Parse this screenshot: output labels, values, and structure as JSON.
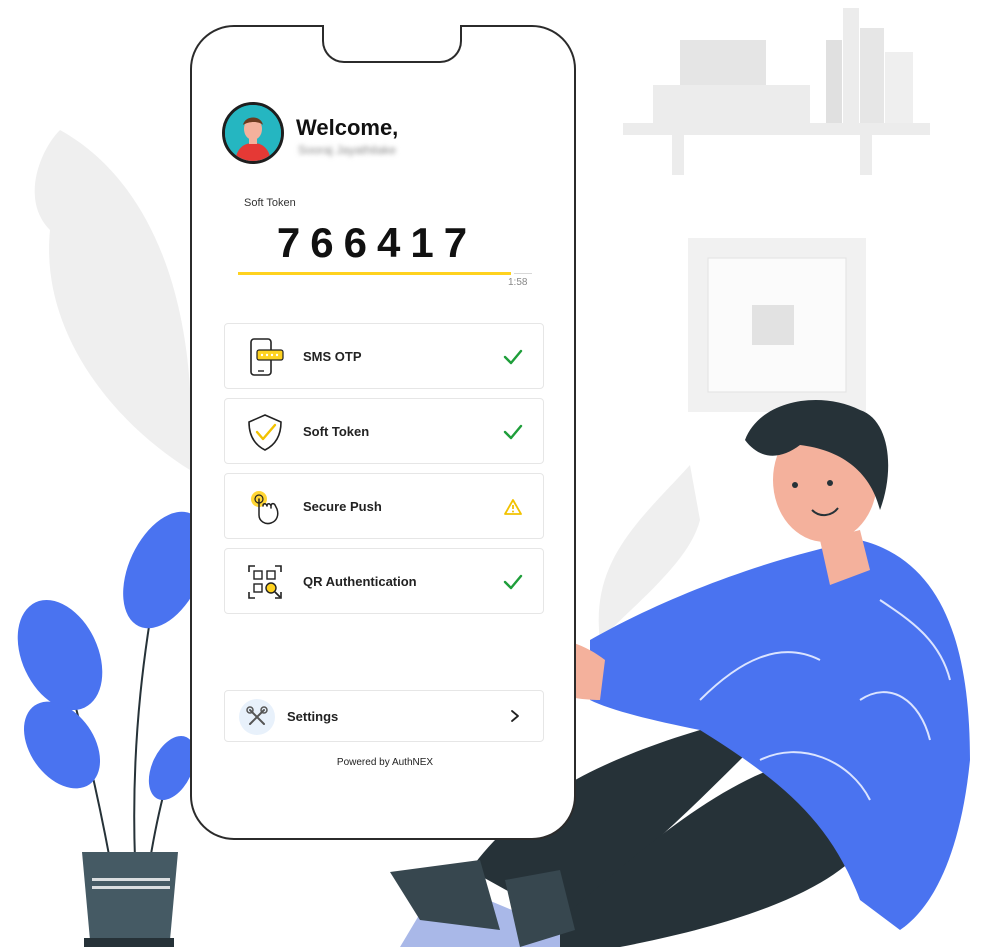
{
  "welcome": {
    "greeting": "Welcome,",
    "username": "Sooraj Jayathilake"
  },
  "token": {
    "label": "Soft Token",
    "value": "766417",
    "timer": "1:58",
    "progress": 0.93
  },
  "methods": [
    {
      "label": "SMS OTP",
      "icon": "sms-otp-icon",
      "status": "check"
    },
    {
      "label": "Soft Token",
      "icon": "shield-check-icon",
      "status": "check"
    },
    {
      "label": "Secure Push",
      "icon": "tap-hand-icon",
      "status": "warning"
    },
    {
      "label": "QR Authentication",
      "icon": "qr-scan-icon",
      "status": "check"
    }
  ],
  "settings": {
    "label": "Settings",
    "icon": "tools-icon"
  },
  "footer": {
    "powered_by": "Powered by AuthNEX"
  },
  "colors": {
    "check": "#1e9e3a",
    "warning": "#f2c200",
    "accent_yellow": "#ffd21f",
    "illustration_blue": "#4a73f0",
    "pants": "#263238",
    "pot": "#455a64"
  }
}
